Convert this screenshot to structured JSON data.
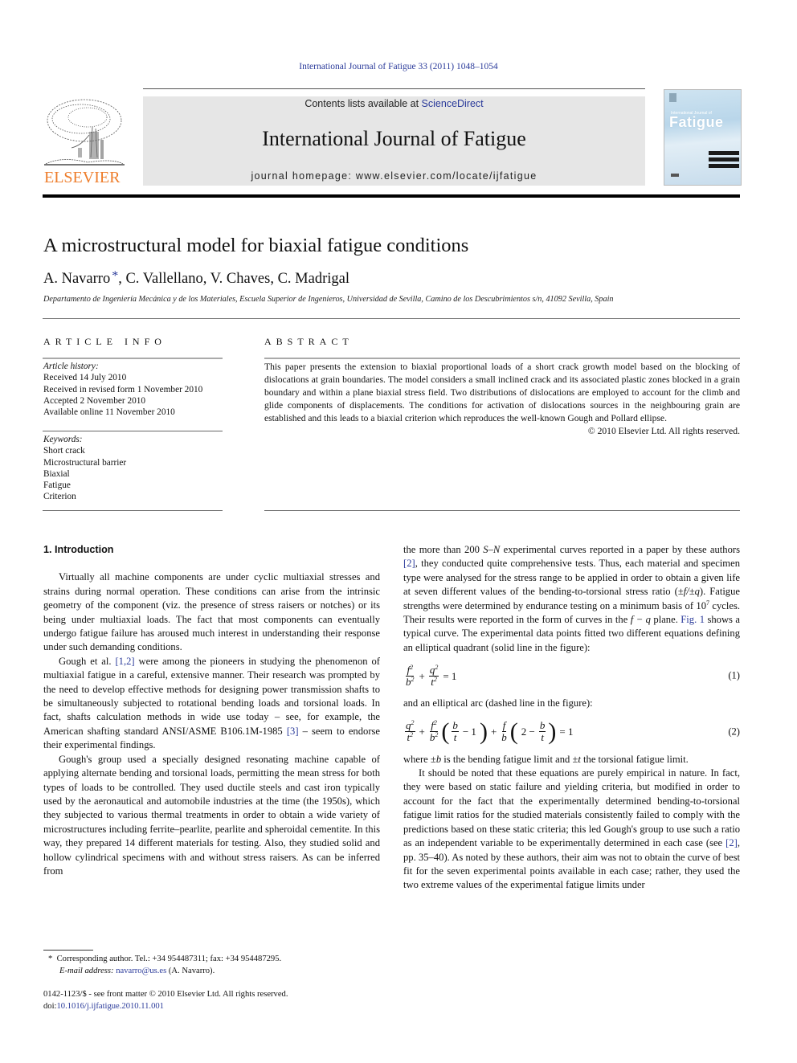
{
  "running_header": "International Journal of Fatigue 33 (2011) 1048–1054",
  "masthead": {
    "publisher_logo_text": "ELSEVIER",
    "contents_prefix": "Contents lists available at ",
    "contents_link": "ScienceDirect",
    "journal_title": "International Journal of Fatigue",
    "homepage": "journal homepage: www.elsevier.com/locate/ijfatigue",
    "cover": {
      "small_title": "International Journal of",
      "big_title": "Fatigue"
    }
  },
  "article": {
    "title": "A microstructural model for biaxial fatigue conditions",
    "authors_first": "A. Navarro",
    "authors_star": "*",
    "authors_rest": ", C. Vallellano, V. Chaves, C. Madrigal",
    "affiliation": "Departamento de Ingeniería Mecánica y de los Materiales, Escuela Superior de Ingenieros, Universidad de Sevilla, Camino de los Descubrimientos s/n, 41092 Sevilla, Spain"
  },
  "article_info": {
    "heading": "ARTICLE INFO",
    "history_label": "Article history:",
    "history": [
      "Received 14 July 2010",
      "Received in revised form 1 November 2010",
      "Accepted 2 November 2010",
      "Available online 11 November 2010"
    ],
    "keywords_label": "Keywords:",
    "keywords": [
      "Short crack",
      "Microstructural barrier",
      "Biaxial",
      "Fatigue",
      "Criterion"
    ]
  },
  "abstract": {
    "heading": "ABSTRACT",
    "text": "This paper presents the extension to biaxial proportional loads of a short crack growth model based on the blocking of dislocations at grain boundaries. The model considers a small inclined crack and its associated plastic zones blocked in a grain boundary and within a plane biaxial stress field. Two distributions of dislocations are employed to account for the climb and glide components of displacements. The conditions for activation of dislocations sources in the neighbouring grain are established and this leads to a biaxial criterion which reproduces the well-known Gough and Pollard ellipse.",
    "copyright": "© 2010 Elsevier Ltd. All rights reserved."
  },
  "body": {
    "section_heading": "1. Introduction",
    "p1": "Virtually all machine components are under cyclic multiaxial stresses and strains during normal operation. These conditions can arise from the intrinsic geometry of the component (viz. the presence of stress raisers or notches) or its being under multiaxial loads. The fact that most components can eventually undergo fatigue failure has aroused much interest in understanding their response under such demanding conditions.",
    "p2_a": "Gough et al. ",
    "p2_ref1": "[1,2]",
    "p2_b": " were among the pioneers in studying the phenomenon of multiaxial fatigue in a careful, extensive manner. Their research was prompted by the need to develop effective methods for designing power transmission shafts to be simultaneously subjected to rotational bending loads and torsional loads. In fact, shafts calculation methods in wide use today – see, for example, the American shafting standard ANSI/ASME B106.1M-1985 ",
    "p2_ref2": "[3]",
    "p2_c": " – seem to endorse their experimental findings.",
    "p3": "Gough's group used a specially designed resonating machine capable of applying alternate bending and torsional loads, permitting the mean stress for both types of loads to be controlled. They used ductile steels and cast iron typically used by the aeronautical and automobile industries at the time (the 1950s), which they subjected to various thermal treatments in order to obtain a wide variety of microstructures including ferrite–pearlite, pearlite and spheroidal cementite. In this way, they prepared 14 different materials for testing. Also, they studied solid and hollow cylindrical specimens with and without stress raisers. As can be inferred from",
    "r1_a": "the more than 200 ",
    "r1_sn": "S–N",
    "r1_b": " experimental curves reported in a paper by these authors ",
    "r1_ref": "[2]",
    "r1_c": ", they conducted quite comprehensive tests. Thus, each material and specimen type were analysed for the stress range to be applied in order to obtain a given life at seven different values of the bending-to-torsional stress ratio (",
    "r1_ratio": "±f/±q",
    "r1_d": "). Fatigue strengths were determined by endurance testing on a minimum basis of 10",
    "r1_exp": "7",
    "r1_e": " cycles. Their results were reported in the form of curves in the ",
    "r1_plane": "f − q",
    "r1_f": " plane. ",
    "r1_fig": "Fig. 1",
    "r1_g": " shows a typical curve. The experimental data points fitted two different equations defining an elliptical quadrant (solid line in the figure):",
    "eq1_num": "(1)",
    "between_eq": "and an elliptical arc (dashed line in the figure):",
    "eq2_num": "(2)",
    "r2_a": "where ±",
    "r2_b_sym": "b",
    "r2_b": " is the bending fatigue limit and ±",
    "r2_t_sym": "t",
    "r2_c": " the torsional fatigue limit.",
    "r3_a": "It should be noted that these equations are purely empirical in nature. In fact, they were based on static failure and yielding criteria, but modified in order to account for the fact that the experimentally determined bending-to-torsional fatigue limit ratios for the studied materials consistently failed to comply with the predictions based on these static criteria; this led Gough's group to use such a ratio as an independent variable to be experimentally determined in each case (see ",
    "r3_ref": "[2]",
    "r3_b": ", pp. 35–40). As noted by these authors, their aim was not to obtain the curve of best fit for the seven experimental points available in each case; rather, they used the two extreme values of the experimental fatigue limits under"
  },
  "footnotes": {
    "star": "*",
    "corresponding": "Corresponding author. Tel.: +34 954487311; fax: +34 954487295.",
    "email_label": "E-mail address:",
    "email": "navarro@us.es",
    "email_suffix": " (A. Navarro).",
    "front_matter": "0142-1123/$ - see front matter © 2010 Elsevier Ltd. All rights reserved.",
    "doi_label": "doi:",
    "doi": "10.1016/j.ijfatigue.2010.11.001"
  },
  "colors": {
    "link": "#2a3a9a",
    "elsevier_orange": "#ee7d2b",
    "masthead_bg": "#e6e6e6"
  }
}
